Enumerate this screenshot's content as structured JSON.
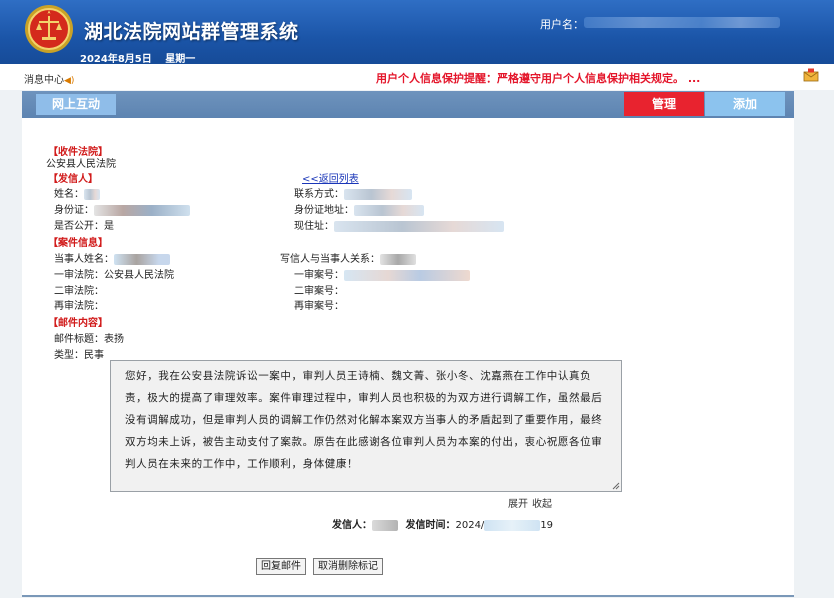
{
  "header": {
    "title": "湖北法院网站群管理系统",
    "date": "2024年8月5日",
    "weekday": "星期一",
    "user_label": "用户名："
  },
  "notice": {
    "message_center": "消息中心",
    "privacy_text": "用户个人信息保护提醒：严格遵守用户个人信息保护相关规定。  ..."
  },
  "nav": {
    "tab_online": "网上互动",
    "manage_label": "管理",
    "add_label": "添加"
  },
  "mail": {
    "receiving_court_heading": "【收件法院】",
    "receiving_court": "公安县人民法院",
    "sender_heading": "【发信人】",
    "back_link": "<<返回列表",
    "name_label": "姓名：",
    "contact_label": "联系方式：",
    "idcard_label": "身份证：",
    "idcard_address_label": "身份证地址：",
    "public_label": "是否公开：",
    "public_value": "是",
    "current_address_label": "现住址：",
    "case_heading": "【案件信息】",
    "party_name_label": "当事人姓名：",
    "relation_label": "写信人与当事人关系：",
    "first_court_label": "一审法院：",
    "first_court_value": "公安县人民法院",
    "first_case_no_label": "一审案号：",
    "second_court_label": "二审法院：",
    "second_case_no_label": "二审案号：",
    "retrial_court_label": "再审法院：",
    "retrial_case_no_label": "再审案号：",
    "content_heading": "【邮件内容】",
    "subject_label": "邮件标题：",
    "subject_value": "表扬",
    "type_label": "类型：",
    "type_value": "民事",
    "body": "您好，我在公安县法院诉讼一案中，审判人员王诗楠、魏文菁、张小冬、沈嘉燕在工作中认真负责，极大的提高了审理效率。案件审理过程中，审判人员也积极的为双方进行调解工作，虽然最后没有调解成功，但是审判人员的调解工作仍然对化解本案双方当事人的矛盾起到了重要作用，最终双方均未上诉，被告主动支付了案款。原告在此感谢各位审判人员为本案的付出，衷心祝愿各位审判人员在未来的工作中，工作顺利，身体健康！",
    "expand_label": "展开",
    "collapse_label": "收起",
    "sender_label": "发信人：",
    "send_time_label": "发信时间：",
    "send_time_value": "2024/",
    "send_time_tail": "19"
  },
  "actions": {
    "reply_label": "回复邮件",
    "cancel_delete_label": "取消删除标记"
  },
  "colors": {
    "header_blue": "#1b55a8",
    "nav_blue": "#5d84b1",
    "manage_red": "#e8232f",
    "add_blue": "#8cc3ee",
    "notice_red": "#e4162b"
  },
  "icons": [
    "court-emblem-icon",
    "speaker-icon",
    "mail-envelope-icon",
    "resize-grip-icon"
  ]
}
